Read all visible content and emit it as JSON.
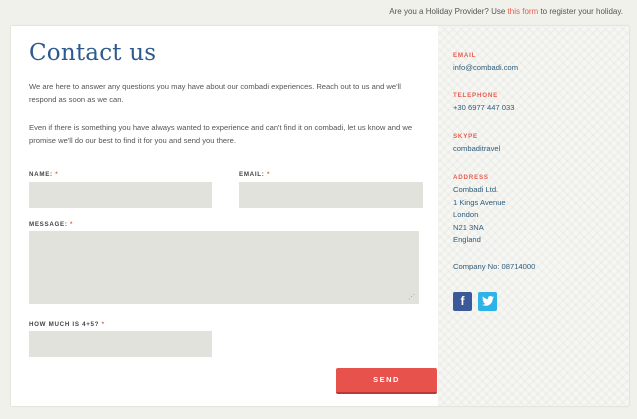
{
  "topbar": {
    "prefix": "Are you a Holiday Provider? Use ",
    "link": "this form",
    "suffix": " to register your holiday."
  },
  "page": {
    "title": "Contact us",
    "intro1": "We are here to answer any questions you may have about our combadi experiences. Reach out to us and we'll respond as soon as we can.",
    "intro2": "Even if there is something you have always wanted to experience and can't find it on combadi, let us know and we promise we'll do our best to find it for you and send you there."
  },
  "form": {
    "name_label": "NAME:",
    "email_label": "EMAIL:",
    "message_label": "MESSAGE:",
    "captcha_label": "HOW MUCH IS 4+5?",
    "required_mark": "*",
    "name_value": "",
    "email_value": "",
    "message_value": "",
    "captcha_value": "",
    "send_label": "SEND"
  },
  "sidebar": {
    "email_title": "EMAIL",
    "email": "info@combadi.com",
    "telephone_title": "TELEPHONE",
    "telephone": "+30 6977 447 033",
    "skype_title": "SKYPE",
    "skype": "combaditravel",
    "address_title": "ADDRESS",
    "address": [
      "Combadi Ltd.",
      "1 Kings Avenue",
      "London",
      "N21 3NA",
      "England"
    ],
    "company_no": "Company No: 08714000",
    "social": [
      {
        "icon": "facebook-icon",
        "glyph": "f",
        "color": "#3b5999"
      },
      {
        "icon": "twitter-icon",
        "glyph": "bird",
        "color": "#2db3e6"
      }
    ]
  }
}
